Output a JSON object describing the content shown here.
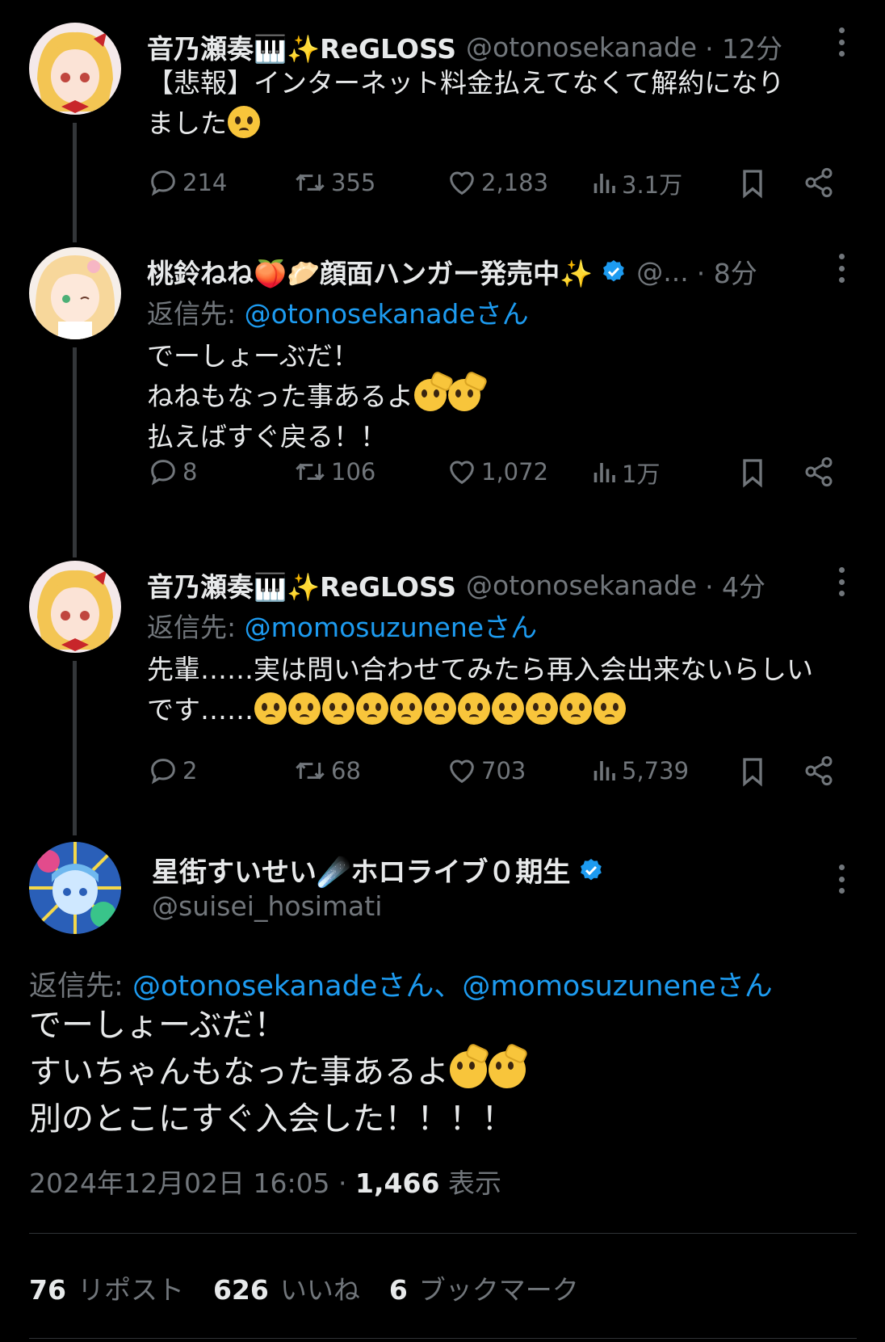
{
  "tweets": [
    {
      "name": "音乃瀬奏🎹✨ReGLOSS",
      "handle": "@otonosekanade",
      "time": "· 12分",
      "line1": "【悲報】インターネット料金払えてなくて解約になり",
      "line2": "ました",
      "replies": "214",
      "reposts": "355",
      "likes": "2,183",
      "views": "3.1万"
    },
    {
      "name": "桃鈴ねね🍑🥟顔面ハンガー発売中✨",
      "handle": "@...",
      "time": "· 8分",
      "reply_label": "返信先:",
      "reply_to": "@otonosekanadeさん",
      "line1": "でーしょーぶだ！",
      "line2": "ねねもなった事あるよ",
      "line3": "払えばすぐ戻る！！",
      "replies": "8",
      "reposts": "106",
      "likes": "1,072",
      "views": "1万"
    },
    {
      "name": "音乃瀬奏🎹✨ReGLOSS",
      "handle": "@otonosekanade",
      "time": "· 4分",
      "reply_label": "返信先:",
      "reply_to": "@momosuzuneneさん",
      "line1": "先輩……実は問い合わせてみたら再入会出来ないらしい",
      "line2": "です……",
      "replies": "2",
      "reposts": "68",
      "likes": "703",
      "views": "5,739"
    }
  ],
  "main": {
    "name": "星街すいせい☄️ホロライブ０期生",
    "handle": "@suisei_hosimati",
    "reply_label": "返信先:",
    "reply_to": "@otonosekanadeさん、@momosuzuneneさん",
    "line1": "でーしょーぶだ！",
    "line2": "すいちゃんもなった事あるよ",
    "line3": "別のとこにすぐ入会した！！！！",
    "date": "2024年12月02日 16:05 ·",
    "views_count": "1,466",
    "views_label": "表示",
    "reposts_count": "76",
    "reposts_label": "リポスト",
    "likes_count": "626",
    "likes_label": "いいね",
    "bookmarks_count": "6",
    "bookmarks_label": "ブックマーク"
  },
  "colors": {
    "link": "#1d9bf0",
    "muted": "#71767b",
    "text": "#e7e9ea",
    "background": "#000000"
  },
  "icons": [
    "reply-icon",
    "repost-icon",
    "like-icon",
    "views-icon",
    "bookmark-icon",
    "share-icon",
    "more-icon",
    "verified-icon",
    "pleading-face-emoji",
    "saluting-face-emoji"
  ]
}
